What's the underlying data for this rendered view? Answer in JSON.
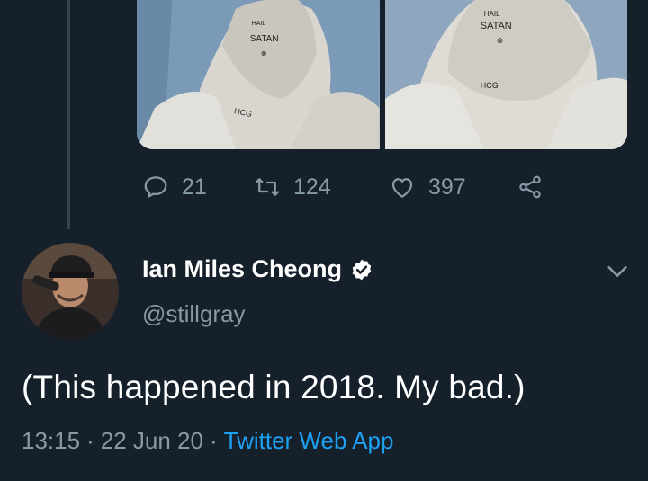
{
  "previous_tweet": {
    "media": [
      {
        "name": "statue-photo-left",
        "graffiti": [
          "HAIL",
          "SATAN",
          "HCG"
        ]
      },
      {
        "name": "statue-photo-right",
        "graffiti": [
          "HAIL",
          "SATAN",
          "HCG"
        ]
      }
    ],
    "actions": {
      "reply_count": "21",
      "retweet_count": "124",
      "like_count": "397"
    }
  },
  "tweet": {
    "author": {
      "display_name": "Ian Miles Cheong",
      "handle": "@stillgray",
      "verified": true
    },
    "text": "(This happened in 2018. My bad.)",
    "time": "13:15",
    "separator": "·",
    "date": "22 Jun 20",
    "source": "Twitter Web App"
  },
  "colors": {
    "background": "#15202b",
    "muted": "#8899a6",
    "accent": "#1da1f2",
    "thread_line": "#38444d"
  },
  "icons": [
    "reply-icon",
    "retweet-icon",
    "like-icon",
    "share-icon",
    "verified-icon",
    "chevron-down-icon"
  ]
}
